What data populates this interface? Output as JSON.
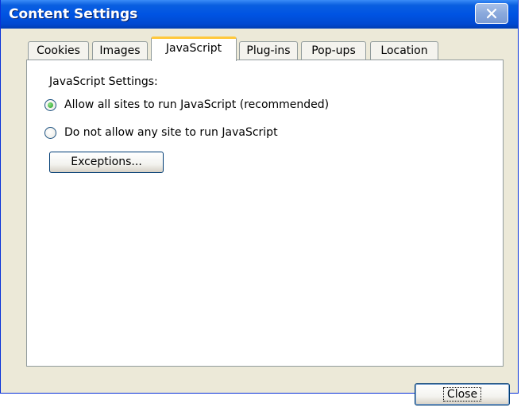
{
  "window": {
    "title": "Content Settings"
  },
  "tabs": [
    {
      "label": "Cookies",
      "active": false
    },
    {
      "label": "Images",
      "active": false
    },
    {
      "label": "JavaScript",
      "active": true
    },
    {
      "label": "Plug-ins",
      "active": false
    },
    {
      "label": "Pop-ups",
      "active": false
    },
    {
      "label": "Location",
      "active": false
    }
  ],
  "javascript": {
    "section_label": "JavaScript Settings:",
    "options": [
      {
        "label": "Allow all sites to run JavaScript (recommended)",
        "checked": true
      },
      {
        "label": "Do not allow any site to run JavaScript",
        "checked": false
      }
    ],
    "exceptions_label": "Exceptions..."
  },
  "footer": {
    "close_label": "Close"
  },
  "colors": {
    "titlebar": "#0054e3",
    "dialog_bg": "#ece9d8",
    "active_tab_accent": "#ffc83c",
    "radio_checked": "#21a121"
  },
  "icons": {
    "close": "close-icon",
    "radio_selected": "radio-selected-icon",
    "radio_unselected": "radio-unselected-icon"
  }
}
